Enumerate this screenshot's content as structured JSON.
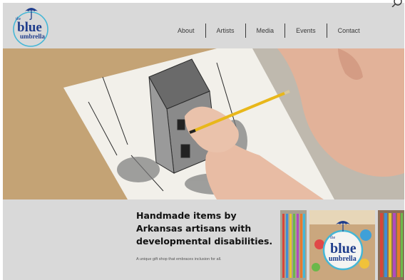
{
  "logo": {
    "line1": "the",
    "line2": "blue",
    "line3": "umbrella"
  },
  "nav": {
    "items": [
      {
        "label": "About"
      },
      {
        "label": "Artists"
      },
      {
        "label": "Media"
      },
      {
        "label": "Events"
      },
      {
        "label": "Contact"
      }
    ]
  },
  "hero": {
    "image": "hand-drawing-pencil-sketch"
  },
  "intro": {
    "headline": "Handmade items by Arkansas artisans with developmental disabilities.",
    "tagline": "A unique gift shop that embraces inclusion for all."
  },
  "gallery": {
    "sign_line1": "the",
    "sign_line2": "blue",
    "sign_line3": "umbrella"
  },
  "colors": {
    "brand_blue": "#1f3d8c",
    "circle_teal": "#45b7d6",
    "background": "#d9d9d9",
    "hero_wood": "#c9a878"
  }
}
